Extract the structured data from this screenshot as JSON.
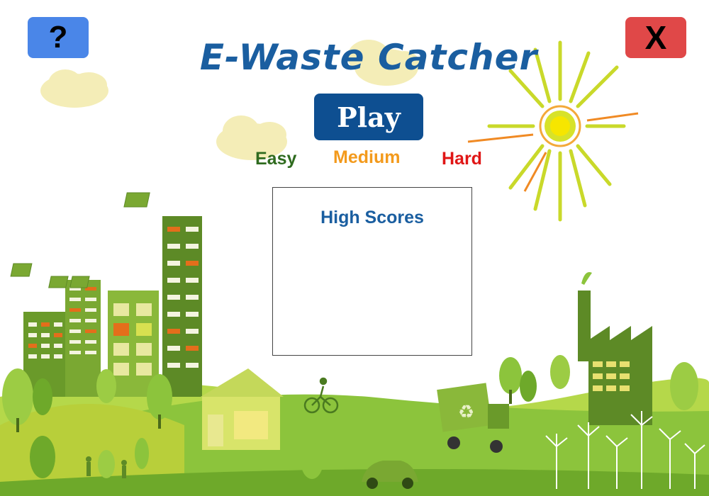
{
  "game": {
    "title": "E-Waste Catcher",
    "help_label": "?",
    "close_label": "X",
    "play_label": "Play",
    "difficulty": {
      "easy": "Easy",
      "medium": "Medium",
      "hard": "Hard"
    },
    "high_scores_title": "High Scores"
  },
  "colors": {
    "title": "#1a5ea0",
    "play_button": "#0e4f91",
    "help_button": "#4a86e8",
    "close_button": "#e04848",
    "easy": "#2f6b1f",
    "medium": "#f39a1c",
    "hard": "#e01616",
    "landscape_green": "#8cc43c",
    "building_green": "#6a9a2a",
    "sun": "#d7e22a"
  },
  "icons": {
    "sun": "sun-icon",
    "recycle": "recycle-icon",
    "solar_panel": "solar-panel-icon",
    "wind_turbine": "wind-turbine-icon",
    "bicycle": "bicycle-icon",
    "car": "car-icon",
    "factory": "factory-icon"
  }
}
